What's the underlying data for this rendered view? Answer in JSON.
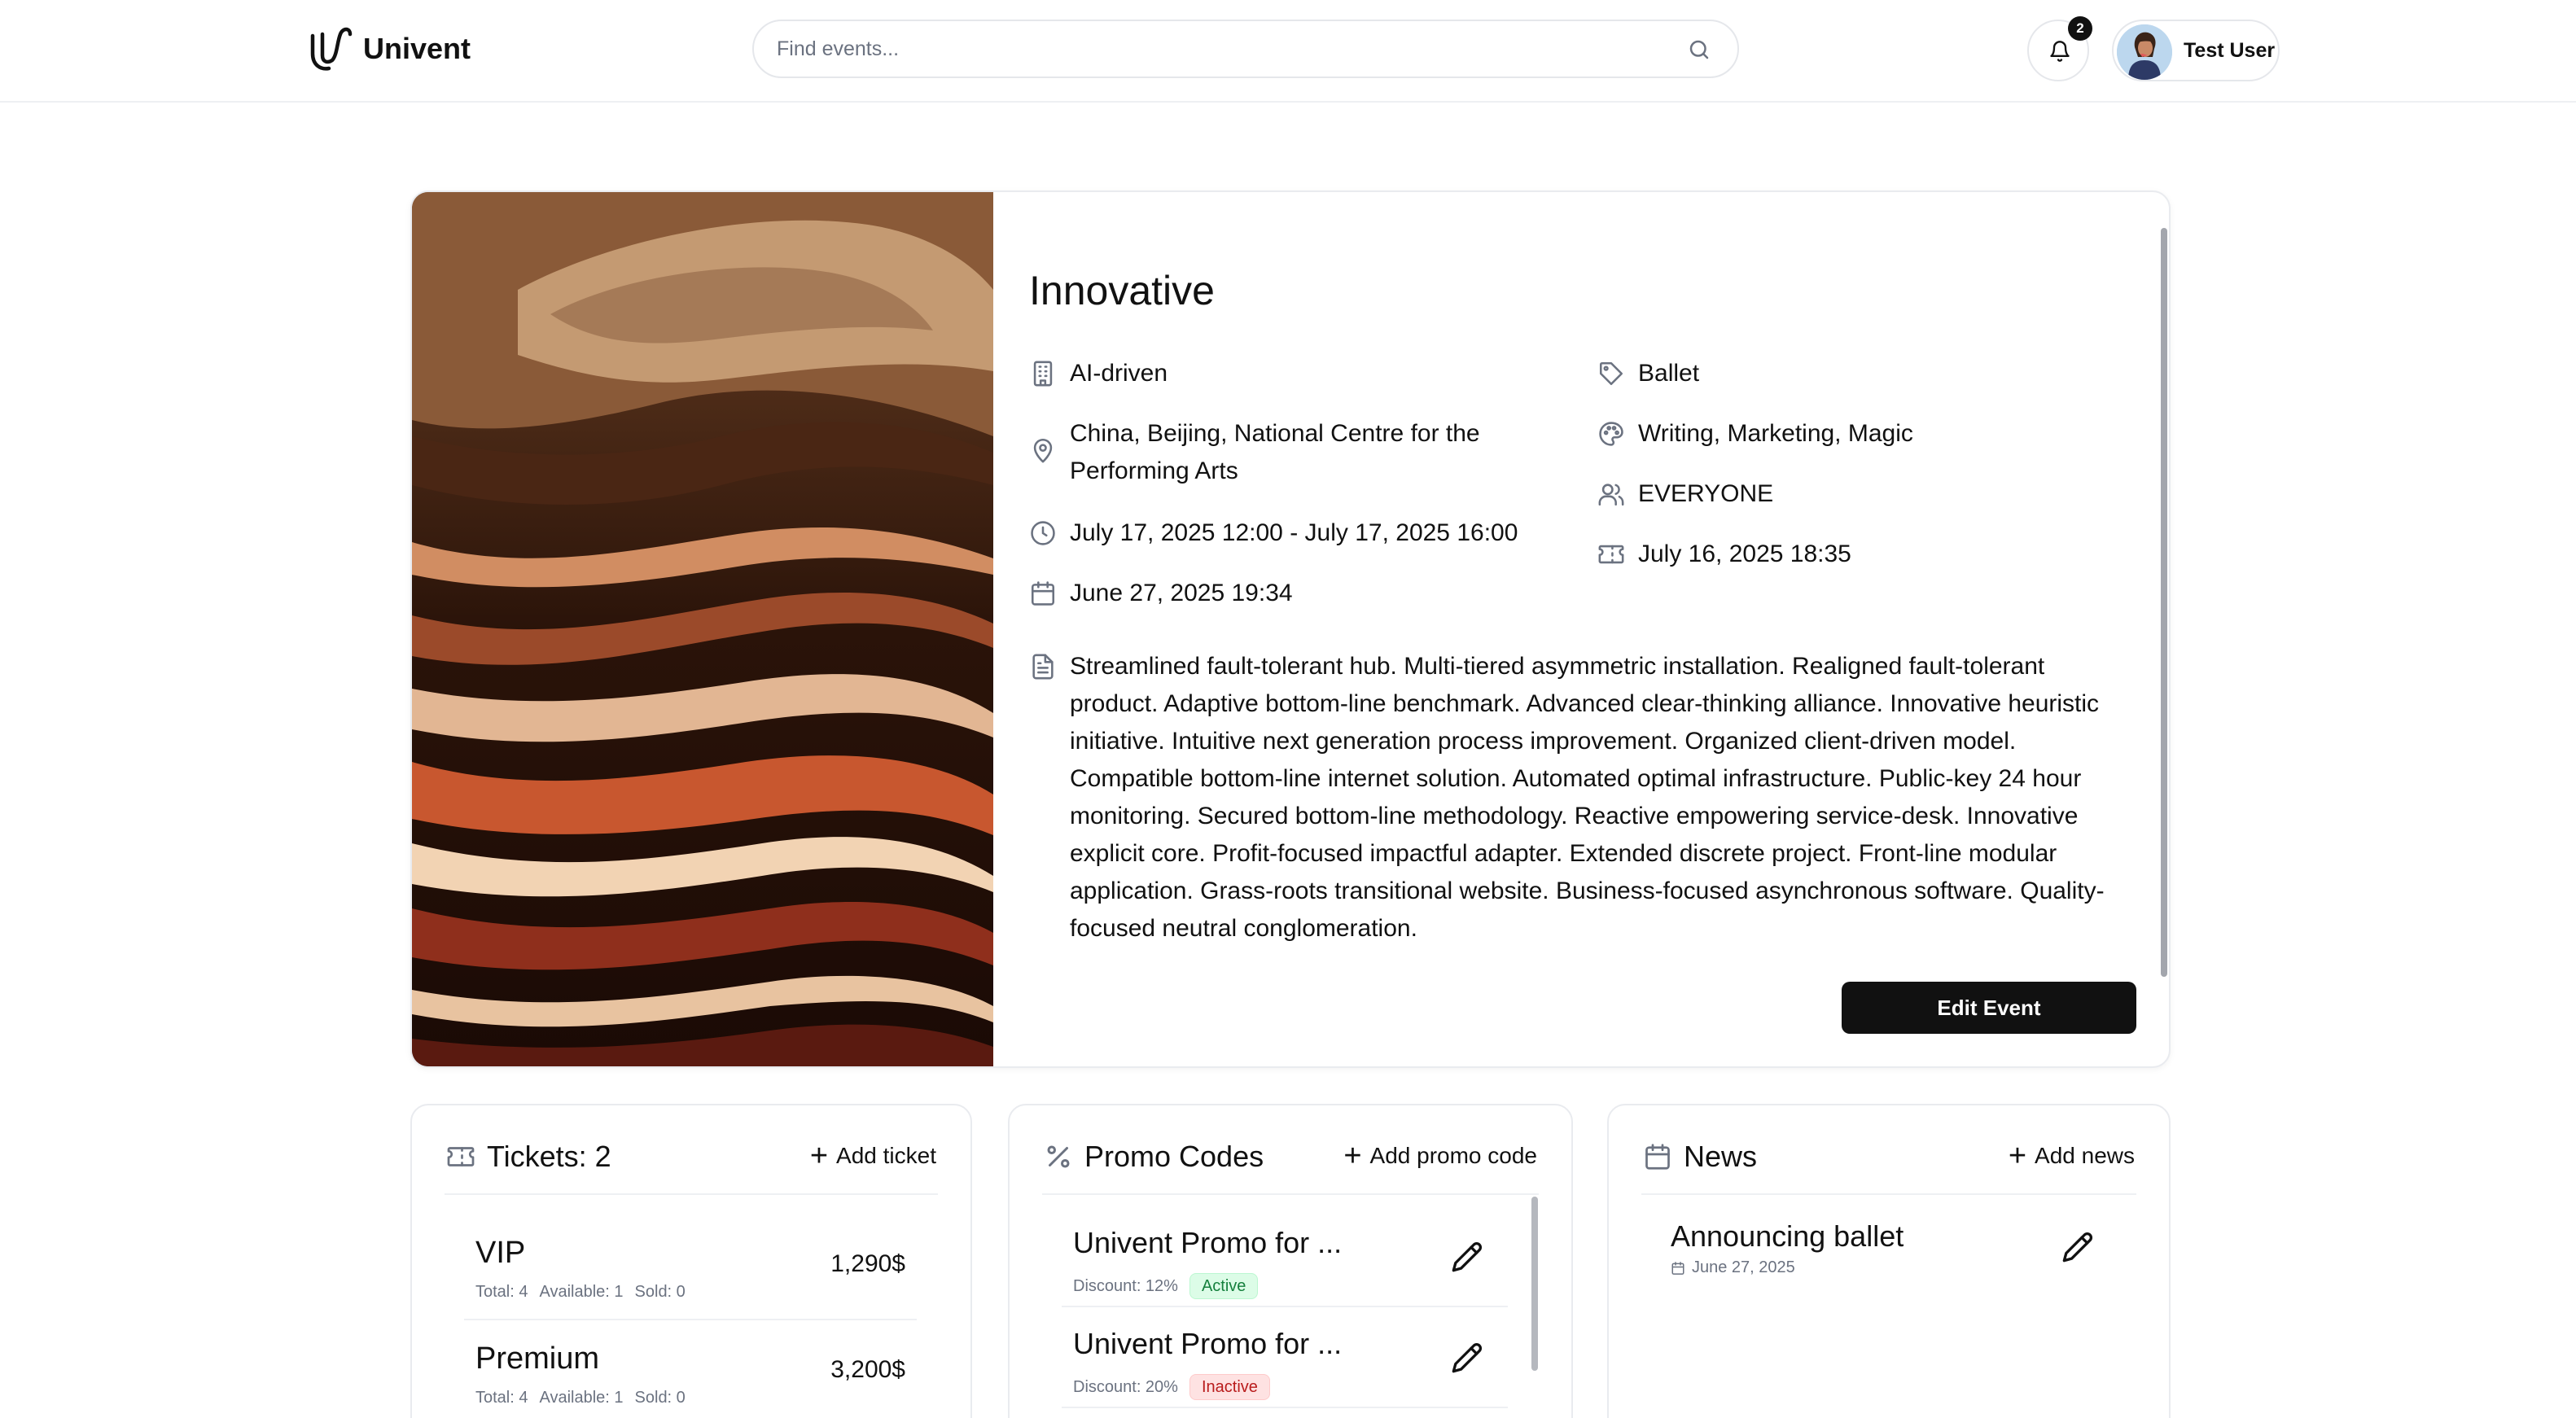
{
  "app": {
    "name": "Univent"
  },
  "header": {
    "search_placeholder": "Find events...",
    "notification_count": "2",
    "user_name": "Test User"
  },
  "event": {
    "title": "Innovative",
    "organization": "AI-driven",
    "location": "China, Beijing, National Centre for the Performing Arts",
    "time_range": "July 17, 2025 12:00 - July 17, 2025 16:00",
    "created_date": "June 27, 2025 19:34",
    "category": "Ballet",
    "themes": "Writing, Marketing, Magic",
    "audience": "EVERYONE",
    "ticket_sale_date": "July 16, 2025 18:35",
    "description": "Streamlined fault-tolerant hub. Multi-tiered asymmetric installation. Realigned fault-tolerant product. Adaptive bottom-line benchmark. Advanced clear-thinking alliance. Innovative heuristic initiative. Intuitive next generation process improvement. Organized client-driven model. Compatible bottom-line internet solution. Automated optimal infrastructure. Public-key 24 hour monitoring. Secured bottom-line methodology. Reactive empowering service-desk. Innovative explicit core. Profit-focused impactful adapter. Extended discrete project. Front-line modular application. Grass-roots transitional website. Business-focused asynchronous software. Quality-focused neutral conglomeration.",
    "edit_label": "Edit Event"
  },
  "tickets": {
    "title": "Tickets: 2",
    "add_label": "Add ticket",
    "items": [
      {
        "name": "VIP",
        "total": "Total: 4",
        "available": "Available: 1",
        "sold": "Sold: 0",
        "price": "1,290$"
      },
      {
        "name": "Premium",
        "total": "Total: 4",
        "available": "Available: 1",
        "sold": "Sold: 0",
        "price": "3,200$"
      }
    ]
  },
  "promo_codes": {
    "title": "Promo Codes",
    "add_label": "Add promo code",
    "items": [
      {
        "name": "Univent Promo for ...",
        "discount": "Discount: 12%",
        "status": "Active"
      },
      {
        "name": "Univent Promo for ...",
        "discount": "Discount: 20%",
        "status": "Inactive"
      }
    ]
  },
  "news": {
    "title": "News",
    "add_label": "Add news",
    "items": [
      {
        "title": "Announcing ballet",
        "date": "June 27, 2025"
      }
    ]
  },
  "colors": {
    "primary": "#111111",
    "border": "#e9ebef",
    "muted_text": "#6b7280",
    "active_badge": "#dcfce7",
    "inactive_badge": "#fee2e2"
  },
  "icons": {
    "logo": "univent-logo-icon",
    "search": "search-icon",
    "notifications": "bell-icon",
    "organization": "building-icon",
    "location": "map-pin-icon",
    "time": "clock-icon",
    "created": "calendar-icon",
    "category": "tag-icon",
    "themes": "palette-icon",
    "audience": "users-icon",
    "ticket_sale": "ticket-icon",
    "description": "file-text-icon",
    "promo": "percent-icon",
    "edit": "pencil-icon"
  }
}
